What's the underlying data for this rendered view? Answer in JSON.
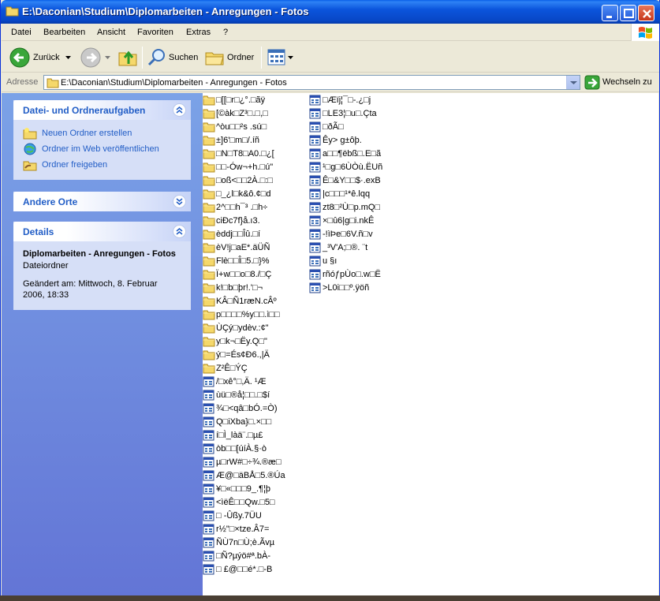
{
  "window": {
    "title": "E:\\Daconian\\Studium\\Diplomarbeiten - Anregungen - Fotos"
  },
  "menu": {
    "items": [
      "Datei",
      "Bearbeiten",
      "Ansicht",
      "Favoriten",
      "Extras",
      "?"
    ]
  },
  "toolbar": {
    "back_label": "Zurück",
    "search_label": "Suchen",
    "folders_label": "Ordner"
  },
  "address": {
    "label": "Adresse",
    "value": "E:\\Daconian\\Studium\\Diplomarbeiten - Anregungen - Fotos",
    "go_label": "Wechseln zu"
  },
  "sidebar": {
    "tasks_panel": {
      "title": "Datei- und Ordneraufgaben",
      "items": [
        "Neuen Ordner erstellen",
        "Ordner im Web veröffentlichen",
        "Ordner freigeben"
      ]
    },
    "places_panel": {
      "title": "Andere Orte"
    },
    "details_panel": {
      "title": "Details",
      "name": "Diplomarbeiten - Anregungen - Fotos",
      "type": "Dateiordner",
      "modified": "Geändert am: Mittwoch, 8. Februar 2006, 18:33"
    }
  },
  "files": {
    "column1": [
      {
        "name": "□[[□r□¿°.□ãÿ",
        "kind": "folder"
      },
      {
        "name": "[©àk□Z³□.□,□",
        "kind": "folder"
      },
      {
        "name": "^òu□□²s .sú□",
        "kind": "folder"
      },
      {
        "name": "±]6'□m□/.íñ",
        "kind": "folder"
      },
      {
        "name": "□N□T8□A0.□¿[",
        "kind": "folder"
      },
      {
        "name": "□□-Ów¬+h.□ú\"",
        "kind": "folder"
      },
      {
        "name": "□oß<□□2À.□:□",
        "kind": "folder"
      },
      {
        "name": "□_¿l□k&ô.¢□d",
        "kind": "folder"
      },
      {
        "name": "2^□□h¯³ .□h÷",
        "kind": "folder"
      },
      {
        "name": "ciÐc7f}å.ı3.",
        "kind": "folder"
      },
      {
        "name": "èddj□□Îû.□í",
        "kind": "folder"
      },
      {
        "name": "èV!j□aE*.äÜÑ",
        "kind": "folder"
      },
      {
        "name": "Flè□□Î□5.□}%",
        "kind": "folder"
      },
      {
        "name": "Ï+w□□o□8./□Ç",
        "kind": "folder"
      },
      {
        "name": "k!□b□þr!.'□¬",
        "kind": "folder"
      },
      {
        "name": "KÂ□Ñ1ræN.cÂº",
        "kind": "folder"
      },
      {
        "name": "p□□□□%y□□.ì□□",
        "kind": "folder"
      },
      {
        "name": "ÙÇý□ydèv.:¢\"",
        "kind": "folder"
      },
      {
        "name": "y□k¬□Ëy.Q□\"",
        "kind": "folder"
      },
      {
        "name": "ý□=És¢Ð6.,|Ä",
        "kind": "folder"
      },
      {
        "name": "Z²Ê□ÝÇ",
        "kind": "folder"
      },
      {
        "name": "/□xê°□,Ä. ¹Æ",
        "kind": "app"
      },
      {
        "name": "ùü□®å¦□□.□$í",
        "kind": "app"
      },
      {
        "name": "¾□<qâ□bÓ.=Ò)",
        "kind": "app"
      },
      {
        "name": "Q□iXba}□.×□□",
        "kind": "app"
      },
      {
        "name": "í□Ì_làä¨.□µ£",
        "kind": "app"
      },
      {
        "name": "òb□□[úíÀ.§·ò",
        "kind": "app"
      },
      {
        "name": "µ□rW#□÷¾.®æ□",
        "kind": "app"
      },
      {
        "name": "Æ@□äBÅ□5.®Úa",
        "kind": "app"
      },
      {
        "name": "¥□«□□□9_.¶¦þ",
        "kind": "app"
      },
      {
        "name": "<ìëÊ□□Qw.□5□",
        "kind": "app"
      },
      {
        "name": " □  -Ûßy.7ÜU",
        "kind": "app"
      },
      {
        "name": "r½\"□×tze.Â7=",
        "kind": "app"
      },
      {
        "name": "ÑÙ7n□Ù;è.Ãvµ",
        "kind": "app"
      },
      {
        "name": "□Ñ?µýö#ª.bÀ-",
        "kind": "app"
      },
      {
        "name": "□ £@□□é*.□-B",
        "kind": "app"
      }
    ],
    "column2": [
      {
        "name": "□Æïj¦¯□-.¿□j",
        "kind": "app"
      },
      {
        "name": "□LE3¦□u□.Çta",
        "kind": "app"
      },
      {
        "name": "□ðÃ□",
        "kind": "app"
      },
      {
        "name": "Êy> g±ôþ.",
        "kind": "app"
      },
      {
        "name": "a□□¶ëbß□.E□ã",
        "kind": "app"
      },
      {
        "name": "¹□g□6ÙÒù.ËUñ",
        "kind": "app"
      },
      {
        "name": "Ê□&Y□□$·.exB",
        "kind": "app"
      },
      {
        "name": "|c□□□¹*ê.lqq",
        "kind": "app"
      },
      {
        "name": "zt8□²Ù□p.mQ□",
        "kind": "app"
      },
      {
        "name": "×□û6|g□i.nkÊ",
        "kind": "app"
      },
      {
        "name": "-!ìÞe□6V.ñ□v",
        "kind": "app"
      },
      {
        "name": "_³V'A;□®. ¨t",
        "kind": "app"
      },
      {
        "name": "u §ı",
        "kind": "app"
      },
      {
        "name": "rñóƒpÙo□.w□Ë",
        "kind": "app"
      },
      {
        "name": ">L0i□□º.ÿöñ",
        "kind": "app"
      }
    ]
  }
}
